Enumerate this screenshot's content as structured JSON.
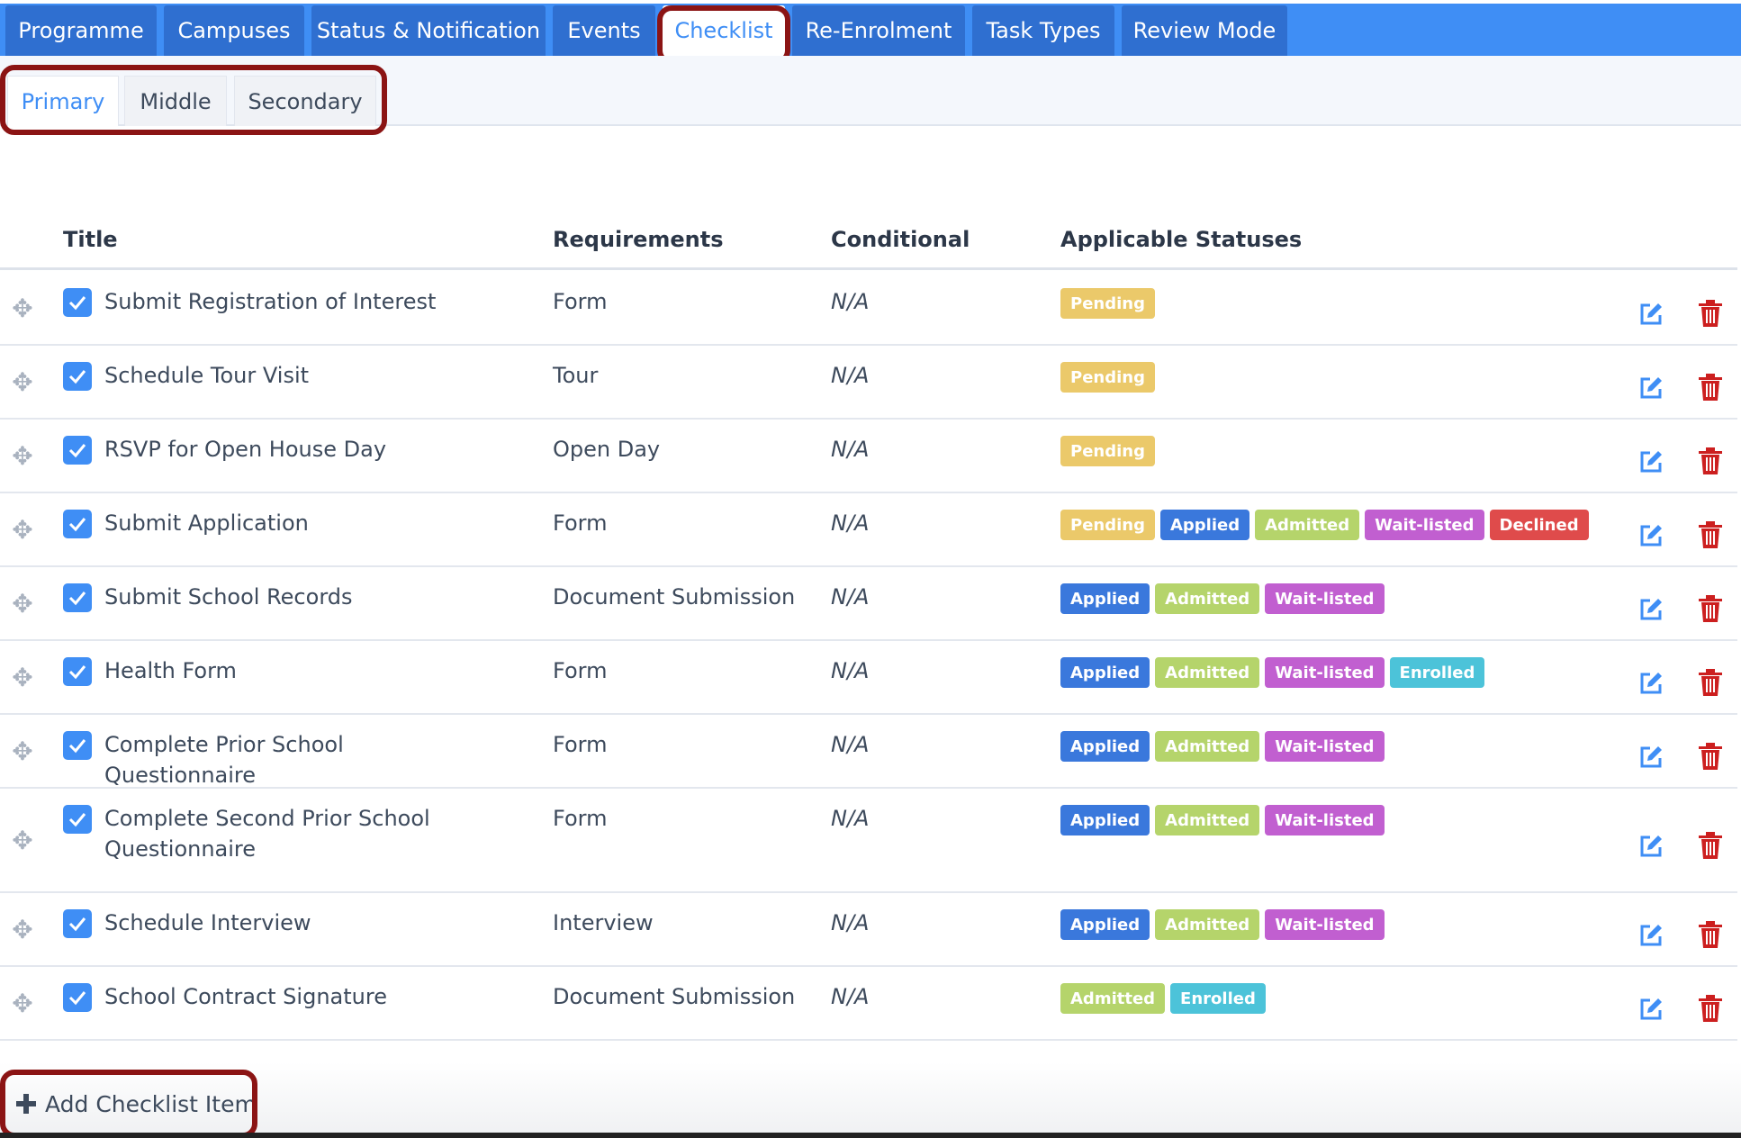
{
  "nav": {
    "tabs": [
      {
        "label": "Programme"
      },
      {
        "label": "Campuses"
      },
      {
        "label": "Status & Notification"
      },
      {
        "label": "Events"
      },
      {
        "label": "Checklist"
      },
      {
        "label": "Re-Enrolment"
      },
      {
        "label": "Task Types"
      },
      {
        "label": "Review Mode"
      }
    ],
    "active": "Checklist"
  },
  "subtabs": {
    "items": [
      {
        "label": "Primary"
      },
      {
        "label": "Middle"
      },
      {
        "label": "Secondary"
      }
    ],
    "active": "Primary"
  },
  "table": {
    "headers": {
      "title": "Title",
      "requirements": "Requirements",
      "conditional": "Conditional",
      "statuses": "Applicable Statuses"
    },
    "rows": [
      {
        "title": "Submit Registration of Interest",
        "requirements": "Form",
        "conditional": "N/A",
        "checked": true,
        "statuses": [
          "Pending"
        ]
      },
      {
        "title": "Schedule Tour Visit",
        "requirements": "Tour",
        "conditional": "N/A",
        "checked": true,
        "statuses": [
          "Pending"
        ]
      },
      {
        "title": "RSVP for Open House Day",
        "requirements": "Open Day",
        "conditional": "N/A",
        "checked": true,
        "statuses": [
          "Pending"
        ]
      },
      {
        "title": "Submit Application",
        "requirements": "Form",
        "conditional": "N/A",
        "checked": true,
        "statuses": [
          "Pending",
          "Applied",
          "Admitted",
          "Wait-listed",
          "Declined"
        ]
      },
      {
        "title": "Submit School Records",
        "requirements": "Document Submission",
        "conditional": "N/A",
        "checked": true,
        "statuses": [
          "Applied",
          "Admitted",
          "Wait-listed"
        ]
      },
      {
        "title": "Health Form",
        "requirements": "Form",
        "conditional": "N/A",
        "checked": true,
        "statuses": [
          "Applied",
          "Admitted",
          "Wait-listed",
          "Enrolled"
        ]
      },
      {
        "title": "Complete Prior School Questionnaire",
        "requirements": "Form",
        "conditional": "N/A",
        "checked": true,
        "statuses": [
          "Applied",
          "Admitted",
          "Wait-listed"
        ]
      },
      {
        "title": "Complete Second Prior School Questionnaire",
        "requirements": "Form",
        "conditional": "N/A",
        "checked": true,
        "statuses": [
          "Applied",
          "Admitted",
          "Wait-listed"
        ]
      },
      {
        "title": "Schedule Interview",
        "requirements": "Interview",
        "conditional": "N/A",
        "checked": true,
        "statuses": [
          "Applied",
          "Admitted",
          "Wait-listed"
        ]
      },
      {
        "title": "School Contract Signature",
        "requirements": "Document Submission",
        "conditional": "N/A",
        "checked": true,
        "statuses": [
          "Admitted",
          "Enrolled"
        ]
      }
    ]
  },
  "status_colors": {
    "Pending": "#ebc96a",
    "Applied": "#3a78dc",
    "Admitted": "#b5d46b",
    "Wait-listed": "#c15fd0",
    "Declined": "#df4b4b",
    "Enrolled": "#4cc3d9"
  },
  "icons": {
    "drag": "move-icon",
    "edit": "edit-icon",
    "delete": "trash-icon",
    "add": "plus-icon"
  },
  "footer": {
    "add_label": "Add Checklist Item"
  }
}
